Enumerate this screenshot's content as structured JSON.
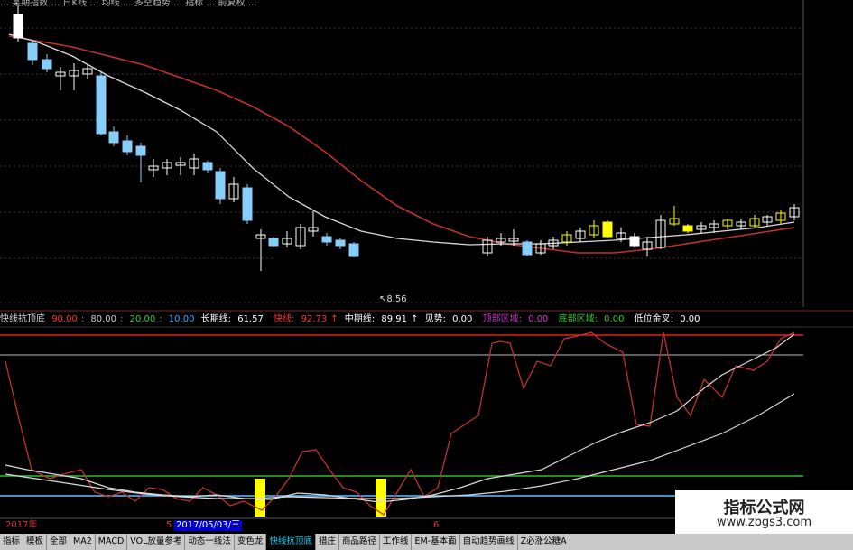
{
  "header": {
    "caption": "… 某期指数  … 日K线 … 均线 … 多空趋势 … 指标 … 前复权 …"
  },
  "main_chart": {
    "low_label": "8.56"
  },
  "indicator": {
    "name": "快线抗顶底",
    "levels": [
      {
        "text": "90.00",
        "color": "#ff3333"
      },
      {
        "text": "80.00",
        "color": "#cccccc"
      },
      {
        "text": "20.00",
        "color": "#33cc33"
      },
      {
        "text": "10.00",
        "color": "#33aaff"
      }
    ],
    "fields": [
      {
        "label": "长期线:",
        "value": "61.57",
        "color": "#ffffff"
      },
      {
        "label": "快线:",
        "value": "92.73",
        "color": "#ff3333"
      },
      {
        "label": "中期线:",
        "value": "89.91",
        "color": "#ffffff"
      },
      {
        "label": "见势:",
        "value": "0.00",
        "color": "#ffffff"
      },
      {
        "label": "顶部区域:",
        "value": "0.00",
        "color": "#cc33cc"
      },
      {
        "label": "底部区域:",
        "value": "0.00",
        "color": "#33cc33"
      },
      {
        "label": "低位金叉:",
        "value": "0.00",
        "color": "#ffffff"
      }
    ]
  },
  "date_axis": {
    "year": "2017年",
    "m5": "5",
    "cursor_date": "2017/05/03/三",
    "m6": "6"
  },
  "tabs": [
    "指标",
    "模板",
    "全部",
    "MA2",
    "MACD",
    "VOL放量参考",
    "动态一线法",
    "变色龙",
    "快线抗顶底",
    "猎庄",
    "商品路径",
    "工作线",
    "EM-基本面",
    "自动趋势画线",
    "Z必涨公糖A"
  ],
  "active_tab": "快线抗顶底",
  "watermark": {
    "title": "指标公式网",
    "url": "www.zbgs3.com"
  },
  "colors": {
    "up": "#ffffff",
    "down": "#87cefa",
    "yellow": "#ffff00",
    "ma_short": "#d9d9d9",
    "ma_long": "#c03030"
  }
}
